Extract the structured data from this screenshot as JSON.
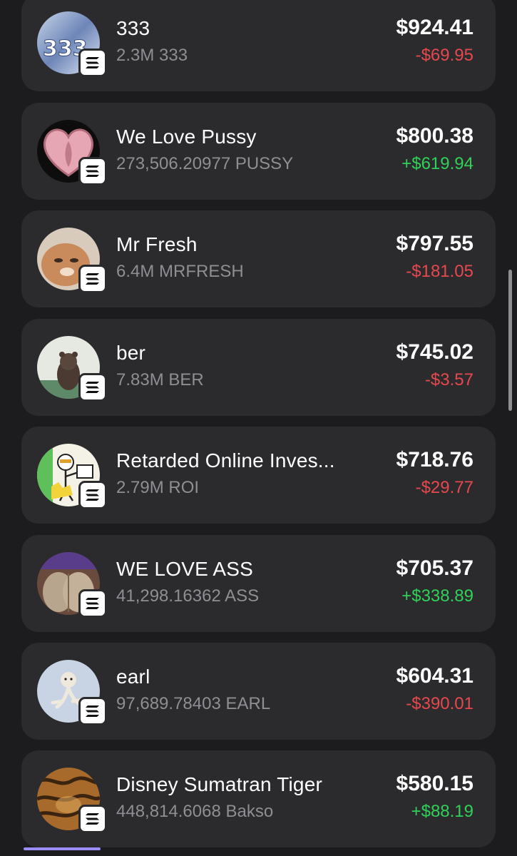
{
  "colors": {
    "background": "#1c1c1e",
    "card": "#2b2b2e",
    "negative": "#e5484d",
    "positive": "#30d158",
    "secondary_text": "#8e8e93"
  },
  "chain_badge_icon": "solana-icon",
  "tokens": [
    {
      "name": "333",
      "balance": "2.3M 333",
      "value": "$924.41",
      "change": "-$69.95",
      "direction": "negative",
      "avatar_icon": "333-logo"
    },
    {
      "name": "We Love Pussy",
      "balance": "273,506.20977 PUSSY",
      "value": "$800.38",
      "change": "+$619.94",
      "direction": "positive",
      "avatar_icon": "heart-logo"
    },
    {
      "name": "Mr Fresh",
      "balance": "6.4M MRFRESH",
      "value": "$797.55",
      "change": "-$181.05",
      "direction": "negative",
      "avatar_icon": "cat-photo"
    },
    {
      "name": "ber",
      "balance": "7.83M BER",
      "value": "$745.02",
      "change": "-$3.57",
      "direction": "negative",
      "avatar_icon": "bear-cat-photo"
    },
    {
      "name": "Retarded Online Inves...",
      "balance": "2.79M ROI",
      "value": "$718.76",
      "change": "-$29.77",
      "direction": "negative",
      "avatar_icon": "cartoon-investor-logo"
    },
    {
      "name": "WE LOVE ASS",
      "balance": "41,298.16362 ASS",
      "value": "$705.37",
      "change": "+$338.89",
      "direction": "positive",
      "avatar_icon": "sparkle-photo"
    },
    {
      "name": "earl",
      "balance": "97,689.78403 EARL",
      "value": "$604.31",
      "change": "-$390.01",
      "direction": "negative",
      "avatar_icon": "earl-creature-photo"
    },
    {
      "name": "Disney Sumatran Tiger",
      "balance": "448,814.6068 Bakso",
      "value": "$580.15",
      "change": "+$88.19",
      "direction": "positive",
      "avatar_icon": "tiger-photo"
    }
  ]
}
